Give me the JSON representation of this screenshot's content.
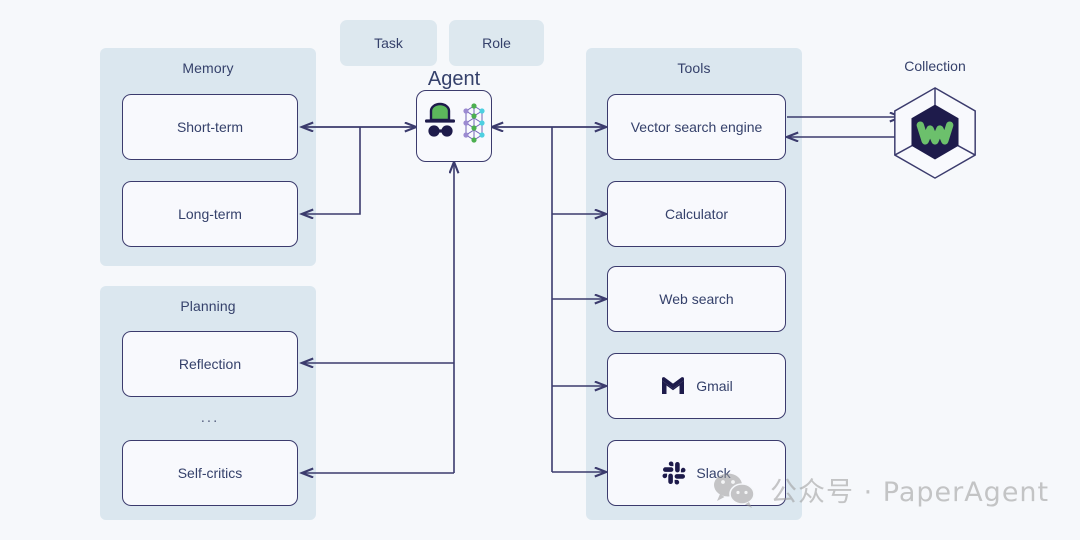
{
  "canvas": {
    "background_color": "#f6f8fb",
    "panel_color": "#dbe7ef",
    "node_fill": "#f8f9fd",
    "stroke_color": "#3b3b6d",
    "text_color": "#35416b",
    "accent_green": "#5cb85c",
    "accent_navy": "#1e1b4b"
  },
  "chips": [
    {
      "label": "Task",
      "icon": "task-chip"
    },
    {
      "label": "Role",
      "icon": "role-chip"
    }
  ],
  "agent": {
    "title": "Agent",
    "icon": "agent-hat-network-icon"
  },
  "memory": {
    "title": "Memory",
    "items": [
      {
        "label": "Short-term"
      },
      {
        "label": "Long-term"
      }
    ]
  },
  "planning": {
    "title": "Planning",
    "items": [
      {
        "label": "Reflection"
      },
      {
        "label": "Self-critics"
      }
    ],
    "ellipsis": "..."
  },
  "tools": {
    "title": "Tools",
    "items": [
      {
        "label": "Vector search engine",
        "icon": null
      },
      {
        "label": "Calculator",
        "icon": null
      },
      {
        "label": "Web search",
        "icon": null
      },
      {
        "label": "Gmail",
        "icon": "gmail-icon"
      },
      {
        "label": "Slack",
        "icon": "slack-icon"
      }
    ]
  },
  "collection": {
    "title": "Collection",
    "icon": "weaviate-hexagon-icon"
  },
  "watermark": {
    "icon": "wechat-icon",
    "text": "公众号 · PaperAgent"
  }
}
